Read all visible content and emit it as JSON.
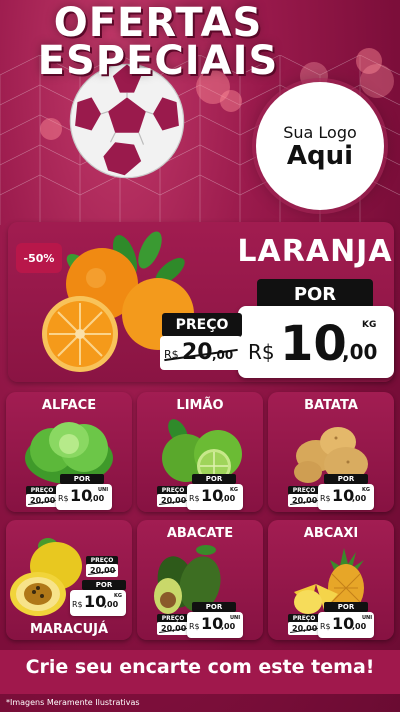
{
  "header": {
    "title_line1": "OFERTAS",
    "title_line2": "ESPECIAIS"
  },
  "logo": {
    "line1": "Sua Logo",
    "line2": "Aqui"
  },
  "featured": {
    "discount": "-50%",
    "name": "LARANJA",
    "por_label": "POR",
    "currency": "R$",
    "price_int": "10",
    "price_dec": ",00",
    "unit": "KG",
    "preco_label": "PREÇO",
    "old_currency": "R$",
    "old_int": "20",
    "old_dec": ",00"
  },
  "products": [
    {
      "name": "ALFACE",
      "por": "POR",
      "preco": "PREÇO",
      "old": "20,00",
      "currency": "R$",
      "int": "10",
      "dec": ",00",
      "unit": "UNI"
    },
    {
      "name": "LIMÃO",
      "por": "POR",
      "preco": "PREÇO",
      "old": "20,00",
      "currency": "R$",
      "int": "10",
      "dec": ",00",
      "unit": "KG"
    },
    {
      "name": "BATATA",
      "por": "POR",
      "preco": "PREÇO",
      "old": "20,00",
      "currency": "R$",
      "int": "10",
      "dec": ",00",
      "unit": "KG"
    },
    {
      "name": "MARACUJÁ",
      "por": "POR",
      "preco": "PREÇO",
      "old": "20,00",
      "currency": "R$",
      "int": "10",
      "dec": ",00",
      "unit": "KG"
    },
    {
      "name": "ABACATE",
      "por": "POR",
      "preco": "PREÇO",
      "old": "20,00",
      "currency": "R$",
      "int": "10",
      "dec": ",00",
      "unit": "UNI"
    },
    {
      "name": "ABCAXI",
      "por": "POR",
      "preco": "PREÇO",
      "old": "20,00",
      "currency": "R$",
      "int": "10",
      "dec": ",00",
      "unit": "UNI"
    }
  ],
  "footer": {
    "cta": "Crie seu encarte com este tema!",
    "note": "*Imagens Meramente Ilustrativas"
  },
  "colors": {
    "background": "#8a1443",
    "card": "#a21d52",
    "accent": "#b8174a",
    "label_bg": "#111111"
  }
}
